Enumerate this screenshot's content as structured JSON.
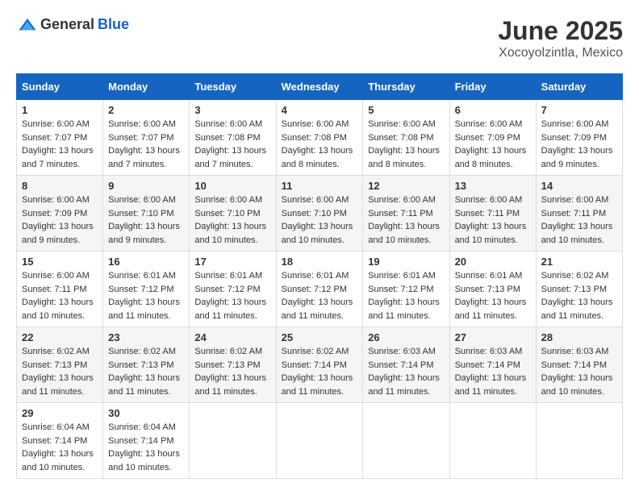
{
  "header": {
    "logo_general": "General",
    "logo_blue": "Blue",
    "title": "June 2025",
    "subtitle": "Xocoyolzintla, Mexico"
  },
  "calendar": {
    "days_of_week": [
      "Sunday",
      "Monday",
      "Tuesday",
      "Wednesday",
      "Thursday",
      "Friday",
      "Saturday"
    ],
    "weeks": [
      [
        {
          "day": "1",
          "sunrise": "Sunrise: 6:00 AM",
          "sunset": "Sunset: 7:07 PM",
          "daylight": "Daylight: 13 hours and 7 minutes."
        },
        {
          "day": "2",
          "sunrise": "Sunrise: 6:00 AM",
          "sunset": "Sunset: 7:07 PM",
          "daylight": "Daylight: 13 hours and 7 minutes."
        },
        {
          "day": "3",
          "sunrise": "Sunrise: 6:00 AM",
          "sunset": "Sunset: 7:08 PM",
          "daylight": "Daylight: 13 hours and 7 minutes."
        },
        {
          "day": "4",
          "sunrise": "Sunrise: 6:00 AM",
          "sunset": "Sunset: 7:08 PM",
          "daylight": "Daylight: 13 hours and 8 minutes."
        },
        {
          "day": "5",
          "sunrise": "Sunrise: 6:00 AM",
          "sunset": "Sunset: 7:08 PM",
          "daylight": "Daylight: 13 hours and 8 minutes."
        },
        {
          "day": "6",
          "sunrise": "Sunrise: 6:00 AM",
          "sunset": "Sunset: 7:09 PM",
          "daylight": "Daylight: 13 hours and 8 minutes."
        },
        {
          "day": "7",
          "sunrise": "Sunrise: 6:00 AM",
          "sunset": "Sunset: 7:09 PM",
          "daylight": "Daylight: 13 hours and 9 minutes."
        }
      ],
      [
        {
          "day": "8",
          "sunrise": "Sunrise: 6:00 AM",
          "sunset": "Sunset: 7:09 PM",
          "daylight": "Daylight: 13 hours and 9 minutes."
        },
        {
          "day": "9",
          "sunrise": "Sunrise: 6:00 AM",
          "sunset": "Sunset: 7:10 PM",
          "daylight": "Daylight: 13 hours and 9 minutes."
        },
        {
          "day": "10",
          "sunrise": "Sunrise: 6:00 AM",
          "sunset": "Sunset: 7:10 PM",
          "daylight": "Daylight: 13 hours and 10 minutes."
        },
        {
          "day": "11",
          "sunrise": "Sunrise: 6:00 AM",
          "sunset": "Sunset: 7:10 PM",
          "daylight": "Daylight: 13 hours and 10 minutes."
        },
        {
          "day": "12",
          "sunrise": "Sunrise: 6:00 AM",
          "sunset": "Sunset: 7:11 PM",
          "daylight": "Daylight: 13 hours and 10 minutes."
        },
        {
          "day": "13",
          "sunrise": "Sunrise: 6:00 AM",
          "sunset": "Sunset: 7:11 PM",
          "daylight": "Daylight: 13 hours and 10 minutes."
        },
        {
          "day": "14",
          "sunrise": "Sunrise: 6:00 AM",
          "sunset": "Sunset: 7:11 PM",
          "daylight": "Daylight: 13 hours and 10 minutes."
        }
      ],
      [
        {
          "day": "15",
          "sunrise": "Sunrise: 6:00 AM",
          "sunset": "Sunset: 7:11 PM",
          "daylight": "Daylight: 13 hours and 10 minutes."
        },
        {
          "day": "16",
          "sunrise": "Sunrise: 6:01 AM",
          "sunset": "Sunset: 7:12 PM",
          "daylight": "Daylight: 13 hours and 11 minutes."
        },
        {
          "day": "17",
          "sunrise": "Sunrise: 6:01 AM",
          "sunset": "Sunset: 7:12 PM",
          "daylight": "Daylight: 13 hours and 11 minutes."
        },
        {
          "day": "18",
          "sunrise": "Sunrise: 6:01 AM",
          "sunset": "Sunset: 7:12 PM",
          "daylight": "Daylight: 13 hours and 11 minutes."
        },
        {
          "day": "19",
          "sunrise": "Sunrise: 6:01 AM",
          "sunset": "Sunset: 7:12 PM",
          "daylight": "Daylight: 13 hours and 11 minutes."
        },
        {
          "day": "20",
          "sunrise": "Sunrise: 6:01 AM",
          "sunset": "Sunset: 7:13 PM",
          "daylight": "Daylight: 13 hours and 11 minutes."
        },
        {
          "day": "21",
          "sunrise": "Sunrise: 6:02 AM",
          "sunset": "Sunset: 7:13 PM",
          "daylight": "Daylight: 13 hours and 11 minutes."
        }
      ],
      [
        {
          "day": "22",
          "sunrise": "Sunrise: 6:02 AM",
          "sunset": "Sunset: 7:13 PM",
          "daylight": "Daylight: 13 hours and 11 minutes."
        },
        {
          "day": "23",
          "sunrise": "Sunrise: 6:02 AM",
          "sunset": "Sunset: 7:13 PM",
          "daylight": "Daylight: 13 hours and 11 minutes."
        },
        {
          "day": "24",
          "sunrise": "Sunrise: 6:02 AM",
          "sunset": "Sunset: 7:13 PM",
          "daylight": "Daylight: 13 hours and 11 minutes."
        },
        {
          "day": "25",
          "sunrise": "Sunrise: 6:02 AM",
          "sunset": "Sunset: 7:14 PM",
          "daylight": "Daylight: 13 hours and 11 minutes."
        },
        {
          "day": "26",
          "sunrise": "Sunrise: 6:03 AM",
          "sunset": "Sunset: 7:14 PM",
          "daylight": "Daylight: 13 hours and 11 minutes."
        },
        {
          "day": "27",
          "sunrise": "Sunrise: 6:03 AM",
          "sunset": "Sunset: 7:14 PM",
          "daylight": "Daylight: 13 hours and 11 minutes."
        },
        {
          "day": "28",
          "sunrise": "Sunrise: 6:03 AM",
          "sunset": "Sunset: 7:14 PM",
          "daylight": "Daylight: 13 hours and 10 minutes."
        }
      ],
      [
        {
          "day": "29",
          "sunrise": "Sunrise: 6:04 AM",
          "sunset": "Sunset: 7:14 PM",
          "daylight": "Daylight: 13 hours and 10 minutes."
        },
        {
          "day": "30",
          "sunrise": "Sunrise: 6:04 AM",
          "sunset": "Sunset: 7:14 PM",
          "daylight": "Daylight: 13 hours and 10 minutes."
        },
        null,
        null,
        null,
        null,
        null
      ]
    ]
  }
}
